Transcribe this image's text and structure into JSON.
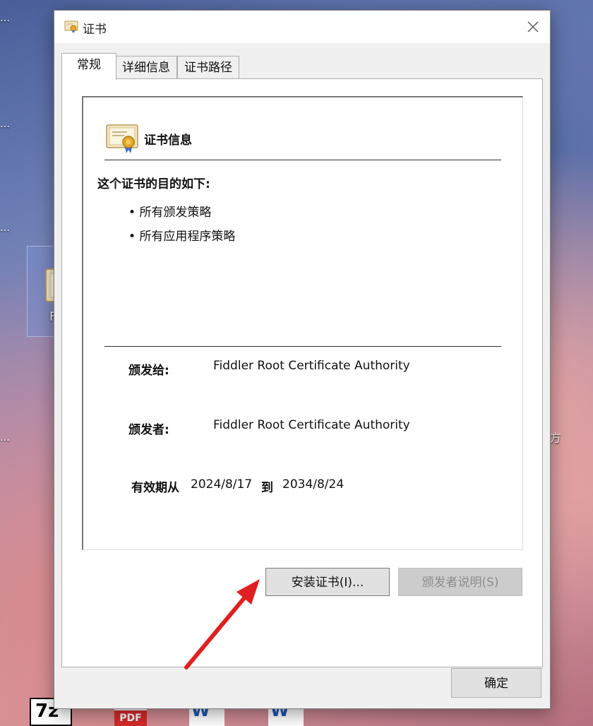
{
  "desktop": {
    "side_labels": [
      "…",
      "…",
      "…",
      "…",
      "…"
    ],
    "right_label": "方",
    "selected_icon_label": "Fiddler_R..."
  },
  "taskbar": {
    "icons": [
      "7z",
      "PDF",
      "W",
      "W"
    ]
  },
  "dialog": {
    "title": "证书",
    "tabs": [
      {
        "label": "常规"
      },
      {
        "label": "详细信息"
      },
      {
        "label": "证书路径"
      }
    ],
    "header_title": "证书信息",
    "purpose_heading": "这个证书的目的如下:",
    "purposes": [
      "所有颁发策略",
      "所有应用程序策略"
    ],
    "issued_to_label": "颁发给:",
    "issued_to_value": "Fiddler Root Certificate Authority",
    "issued_by_label": "颁发者:",
    "issued_by_value": "Fiddler Root Certificate Authority",
    "valid_from_label": "有效期从",
    "valid_from_value": "2024/8/17",
    "valid_to_label": "到",
    "valid_to_value": "2034/8/24",
    "install_button": "安装证书(I)...",
    "issuer_statement_button": "颁发者说明(S)",
    "ok_button": "确定",
    "bullet_glyph": "•"
  },
  "colors": {
    "arrow": "#e02020"
  }
}
